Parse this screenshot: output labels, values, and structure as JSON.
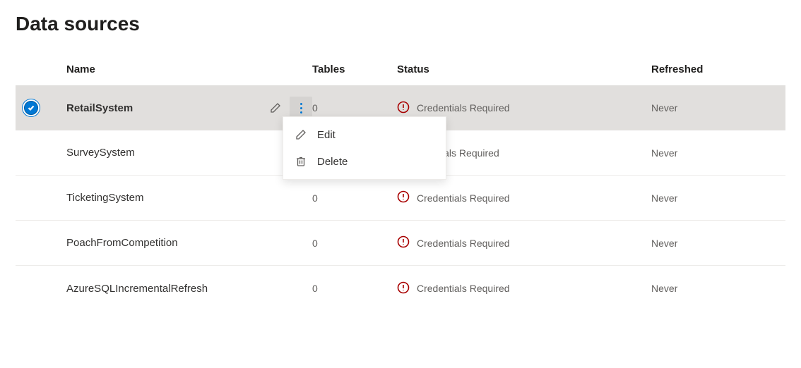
{
  "page_title": "Data sources",
  "columns": {
    "name": "Name",
    "tables": "Tables",
    "status": "Status",
    "refreshed": "Refreshed"
  },
  "rows": [
    {
      "name": "RetailSystem",
      "tables": "0",
      "status": "Credentials Required",
      "refreshed": "Never",
      "selected": true
    },
    {
      "name": "SurveySystem",
      "tables": "",
      "status_visible": "edentials Required",
      "refreshed": "Never",
      "selected": false
    },
    {
      "name": "TicketingSystem",
      "tables": "0",
      "status": "Credentials Required",
      "refreshed": "Never",
      "selected": false
    },
    {
      "name": "PoachFromCompetition",
      "tables": "0",
      "status": "Credentials Required",
      "refreshed": "Never",
      "selected": false
    },
    {
      "name": "AzureSQLIncrementalRefresh",
      "tables": "0",
      "status": "Credentials Required",
      "refreshed": "Never",
      "selected": false
    }
  ],
  "menu": {
    "edit": "Edit",
    "delete": "Delete"
  }
}
